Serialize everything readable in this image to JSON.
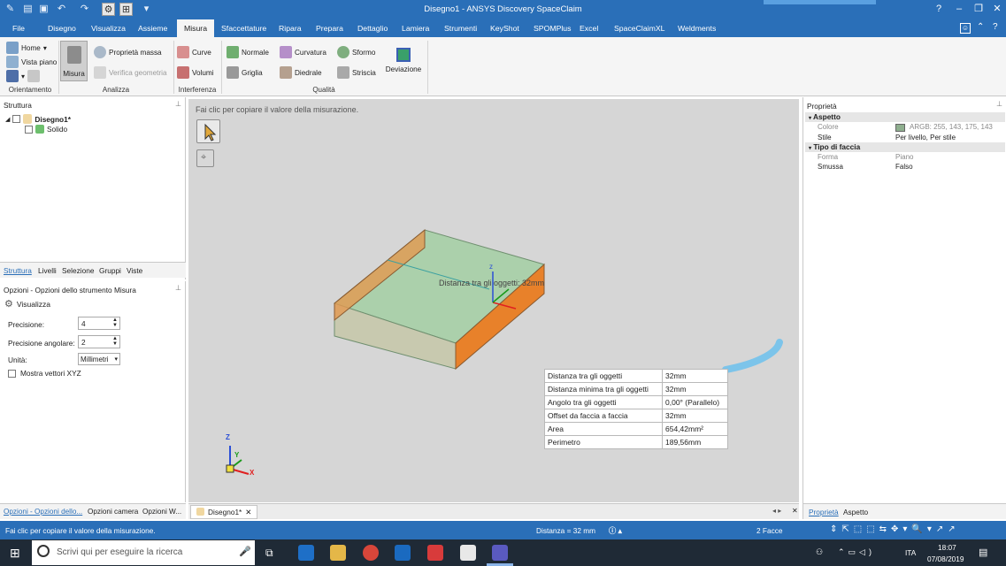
{
  "window": {
    "title": "Disegno1 - ANSYS Discovery SpaceClaim"
  },
  "tabs": [
    "File",
    "Disegno",
    "Visualizza",
    "Assieme",
    "Misura",
    "Sfaccettature",
    "Ripara",
    "Prepara",
    "Dettaglio",
    "Lamiera",
    "Strumenti",
    "KeyShot",
    "SPOMPlus",
    "Excel",
    "SpaceClaimXL",
    "Weldments"
  ],
  "active_tab": "Misura",
  "ribbon": {
    "orientamento": {
      "home": "Home",
      "vista_piano": "Vista piano",
      "group": "Orientamento"
    },
    "analizza": {
      "misura": "Misura",
      "proprieta_massa": "Proprietà massa",
      "verifica_geometria": "Verifica geometria",
      "group": "Analizza"
    },
    "interferenza": {
      "curve": "Curve",
      "volumi": "Volumi",
      "group": "Interferenza"
    },
    "qualita": {
      "normale": "Normale",
      "curvatura": "Curvatura",
      "sformo": "Sformo",
      "griglia": "Griglia",
      "diedrale": "Diedrale",
      "striscia": "Striscia",
      "deviazione": "Deviazione",
      "group": "Qualità"
    }
  },
  "structure": {
    "header": "Struttura",
    "root": "Disegno1*",
    "child": "Solido",
    "tabs": [
      "Struttura",
      "Livelli",
      "Selezione",
      "Gruppi",
      "Viste"
    ]
  },
  "options": {
    "header": "Opzioni - Opzioni dello strumento Misura",
    "visualizza": "Visualizza",
    "precisione_label": "Precisione:",
    "precisione_value": "4",
    "precisione_ang_label": "Precisione angolare:",
    "precisione_ang_value": "2",
    "unita_label": "Unità:",
    "unita_value": "Millimetri",
    "mostra_vettori": "Mostra vettori XYZ",
    "bottom_tabs": [
      "Opzioni - Opzioni dello...",
      "Opzioni camera",
      "Opzioni W..."
    ]
  },
  "viewport": {
    "hint": "Fai clic per copiare il valore della misurazione.",
    "label": "Distanza tra gli oggetti: 32mm",
    "doc_tab": "Disegno1*",
    "axes": {
      "x": "X",
      "y": "Y",
      "z": "Z"
    }
  },
  "measurements": [
    {
      "name": "Distanza tra gli oggetti",
      "value": "32mm"
    },
    {
      "name": "Distanza minima tra gli oggetti",
      "value": "32mm"
    },
    {
      "name": "Angolo tra gli oggetti",
      "value": "0,00° (Parallelo)"
    },
    {
      "name": "Offset da faccia a faccia",
      "value": "32mm"
    },
    {
      "name": "Area",
      "value": "654,42mm²"
    },
    {
      "name": "Perimetro",
      "value": "189,56mm"
    }
  ],
  "properties": {
    "header": "Proprietà",
    "aspetto": "Aspetto",
    "colore_label": "Colore",
    "colore_value": "ARGB: 255, 143, 175, 143",
    "stile_label": "Stile",
    "stile_value": "Per livello, Per stile",
    "tipo_faccia": "Tipo di faccia",
    "forma_label": "Forma",
    "forma_value": "Piano",
    "smussa_label": "Smussa",
    "smussa_value": "Falso",
    "tabs": [
      "Proprietà",
      "Aspetto"
    ]
  },
  "status": {
    "message": "Fai clic per copiare il valore della misurazione.",
    "distance": "Distanza = 32 mm",
    "faces": "2 Facce"
  },
  "taskbar": {
    "search": "Scrivi qui per eseguire la ricerca",
    "lang": "ITA",
    "time": "18:07",
    "date": "07/08/2019"
  },
  "colors": {
    "accent": "#2a6fb8",
    "solid_green": "#9fcf9f",
    "solid_orange": "#e3893e"
  }
}
